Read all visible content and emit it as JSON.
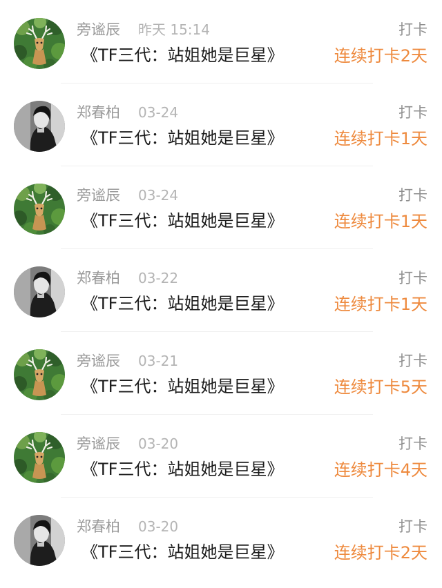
{
  "feed": {
    "items": [
      {
        "user": "旁谧辰",
        "time": "昨天 15:14",
        "action": "打卡",
        "book": "《TF三代：站姐她是巨星》",
        "streak": "连续打卡2天",
        "avatar": "deer-icon"
      },
      {
        "user": "郑春柏",
        "time": "03-24",
        "action": "打卡",
        "book": "《TF三代：站姐她是巨星》",
        "streak": "连续打卡1天",
        "avatar": "woman-portrait-icon"
      },
      {
        "user": "旁谧辰",
        "time": "03-24",
        "action": "打卡",
        "book": "《TF三代：站姐她是巨星》",
        "streak": "连续打卡1天",
        "avatar": "deer-icon"
      },
      {
        "user": "郑春柏",
        "time": "03-22",
        "action": "打卡",
        "book": "《TF三代：站姐她是巨星》",
        "streak": "连续打卡1天",
        "avatar": "woman-portrait-icon"
      },
      {
        "user": "旁谧辰",
        "time": "03-21",
        "action": "打卡",
        "book": "《TF三代：站姐她是巨星》",
        "streak": "连续打卡5天",
        "avatar": "deer-icon"
      },
      {
        "user": "旁谧辰",
        "time": "03-20",
        "action": "打卡",
        "book": "《TF三代：站姐她是巨星》",
        "streak": "连续打卡4天",
        "avatar": "deer-icon"
      },
      {
        "user": "郑春柏",
        "time": "03-20",
        "action": "打卡",
        "book": "《TF三代：站姐她是巨星》",
        "streak": "连续打卡2天",
        "avatar": "woman-portrait-icon"
      }
    ]
  },
  "colors": {
    "streak": "#ee8a3e",
    "name": "#9a9a9a",
    "time": "#b4b4b4",
    "title": "#1c1c1c"
  }
}
